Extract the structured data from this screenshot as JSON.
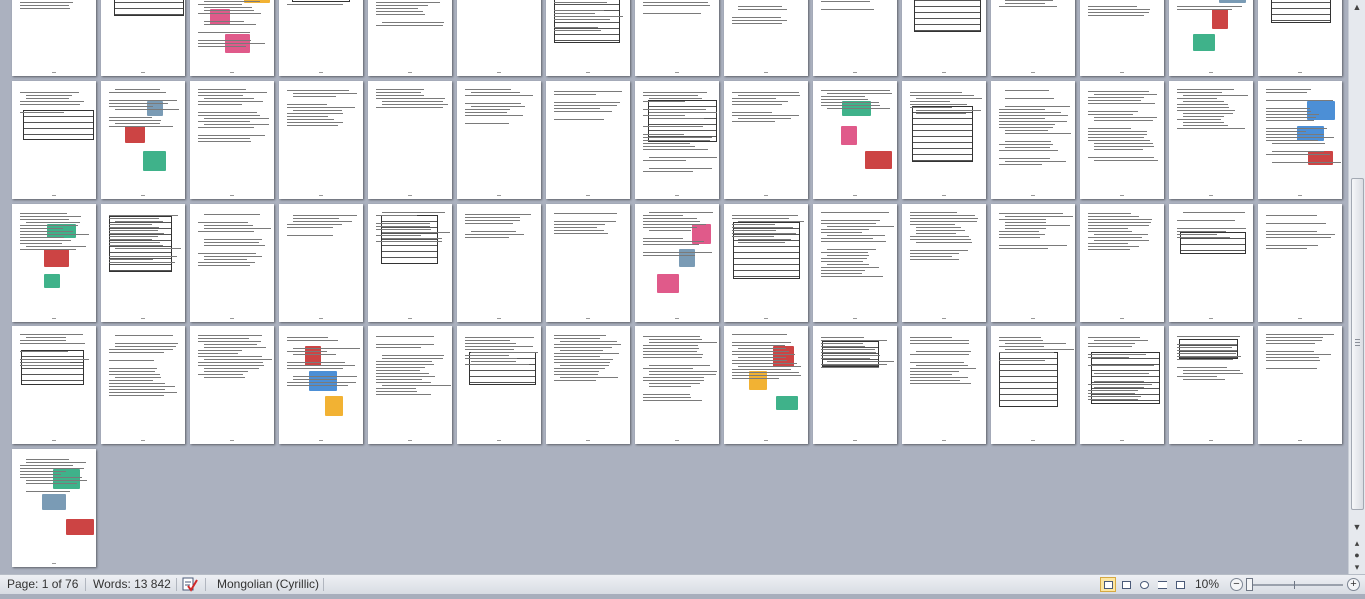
{
  "status_bar": {
    "page_label": "Page: 1 of 76",
    "words_label": "Words: 13 842",
    "proofing_icon": "spell-check-icon",
    "language": "Mongolian (Cyrillic)",
    "zoom_label": "10%",
    "zoom_out_symbol": "−",
    "zoom_in_symbol": "+",
    "zoom_level_percent": 10
  },
  "document": {
    "total_pages": 76,
    "current_page": 1,
    "visible_pages": 61
  },
  "colors": {
    "workspace": "#abb1bf",
    "page": "#ffffff",
    "text_lines": "#7a7a7a",
    "active_view": "#fde7a2"
  },
  "icons": {
    "scroll_up": "▲",
    "scroll_down": "▼",
    "prev_page": "▴",
    "next_page": "▾"
  }
}
